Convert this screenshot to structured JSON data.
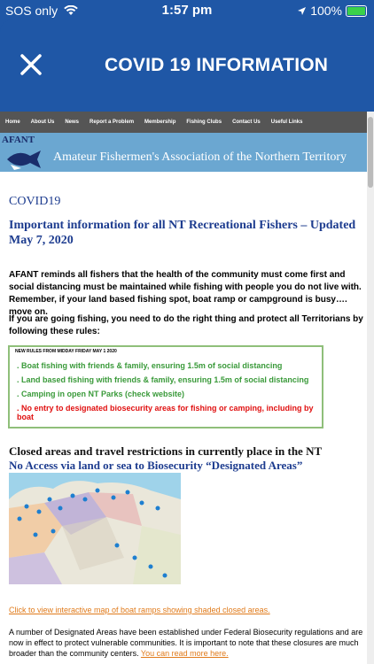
{
  "status_bar": {
    "carrier": "SOS only",
    "time": "1:57 pm",
    "battery": "100%"
  },
  "header": {
    "title": "COVID 19 INFORMATION"
  },
  "nav": {
    "items": [
      "Home",
      "About Us",
      "News",
      "Report a Problem",
      "Membership",
      "Fishing Clubs",
      "Contact Us",
      "Useful Links"
    ]
  },
  "banner": {
    "logo_text": "AFANT",
    "org_name": "Amateur Fishermen's Association of the Northern Territory"
  },
  "article": {
    "heading": "COVID19",
    "subheading": "Important information for all NT Recreational Fishers – Updated May 7, 2020",
    "para1": "AFANT reminds all fishers that the health of the community must come first and social distancing must be maintained while fishing with people you do not live with.  Remember, if your land based fishing spot, boat ramp or campground is busy…. move on.",
    "para2": "If you are going fishing, you need to do the right thing and protect all Territorians by following these rules:",
    "rules_header": "NEW RULES FROM MIDDAY FRIDAY MAY 1 2020",
    "rules": [
      ". Boat fishing with friends & family, ensuring 1.5m of social distancing",
      ". Land based fishing with friends & family, ensuring 1.5m of social distancing",
      ". Camping in open NT Parks (check website)",
      ". No entry to designated biosecurity areas for fishing or camping, including by boat"
    ],
    "closed_heading": "Closed areas and travel restrictions in currently place in the NT",
    "noaccess_heading": "No Access via land or sea to Biosecurity “Designated Areas”",
    "map_link": "Click to view interactive map of boat ramps showing shaded closed areas.",
    "footer_text": "A number of Designated Areas have been established under Federal Biosecurity regulations and are now in effect to protect vulnerable communities. It is important to note that these closures are much broader than the community centers.",
    "read_more": "You can read more here."
  },
  "colors": {
    "header_blue": "#1f57a6",
    "banner_blue": "#6ba7d1",
    "heading_blue": "#1d3c8f",
    "rule_green": "#3a9a3a",
    "rule_red": "#e01010",
    "link_orange": "#e07a1a"
  }
}
